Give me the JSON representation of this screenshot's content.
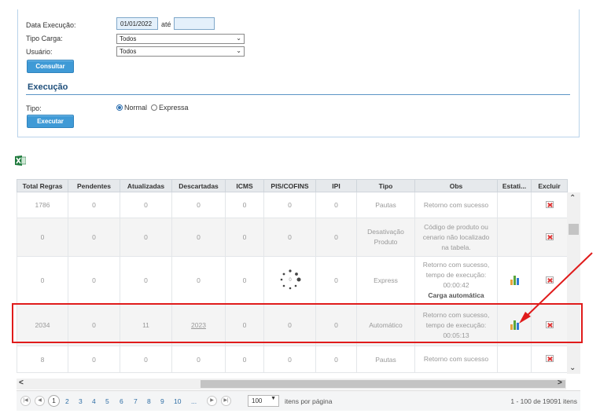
{
  "filters": {
    "data_execucao_label": "Data Execução:",
    "data_inicio": "01/01/2022",
    "ate_label": "até",
    "data_fim": "",
    "tipo_carga_label": "Tipo Carga:",
    "tipo_carga_value": "Todos",
    "usuario_label": "Usuário:",
    "usuario_value": "Todos",
    "consultar_label": "Consultar"
  },
  "execucao": {
    "title": "Execução",
    "tipo_label": "Tipo:",
    "option_normal": "Normal",
    "option_expressa": "Expressa",
    "selected": "Normal",
    "executar_label": "Executar"
  },
  "table": {
    "headers": [
      "Total Regras",
      "Pendentes",
      "Atualizadas",
      "Descartadas",
      "ICMS",
      "PIS/COFINS",
      "IPI",
      "Tipo",
      "Obs",
      "Estati...",
      "Excluir"
    ],
    "rows": [
      {
        "total": "1786",
        "pendentes": "0",
        "atualizadas": "0",
        "descartadas": "0",
        "icms": "0",
        "pis": "0",
        "ipi": "0",
        "tipo": "Pautas",
        "obs": [
          "Retorno com sucesso"
        ]
      },
      {
        "total": "0",
        "pendentes": "0",
        "atualizadas": "0",
        "descartadas": "0",
        "icms": "0",
        "pis": "0",
        "ipi": "0",
        "tipo": "Desativação Produto",
        "obs": [
          "Código de produto ou",
          "cenario não localizado",
          "na tabela."
        ]
      },
      {
        "total": "0",
        "pendentes": "0",
        "atualizadas": "0",
        "descartadas": "0",
        "icms": "0",
        "pis": "",
        "ipi": "0",
        "tipo": "Express",
        "obs": [
          "Retorno com sucesso,",
          "tempo de execução:",
          "00:00:42"
        ],
        "obs_bold": "Carga automática"
      },
      {
        "total": "2034",
        "pendentes": "0",
        "atualizadas": "11",
        "descartadas": "2023",
        "icms": "0",
        "pis": "0",
        "ipi": "0",
        "tipo": "Automático",
        "obs": [
          "Retorno com sucesso,",
          "tempo de execução:",
          "00:05:13"
        ]
      },
      {
        "total": "8",
        "pendentes": "0",
        "atualizadas": "0",
        "descartadas": "0",
        "icms": "0",
        "pis": "0",
        "ipi": "0",
        "tipo": "Pautas",
        "obs": [
          "Retorno com sucesso"
        ]
      }
    ]
  },
  "pager": {
    "pages": [
      "1",
      "2",
      "3",
      "4",
      "5",
      "6",
      "7",
      "8",
      "9",
      "10",
      "..."
    ],
    "current": "1",
    "page_size": "100",
    "items_per_page_label": "itens por página",
    "summary": "1 - 100 de 19091 itens"
  },
  "colors": {
    "highlight": "#e01b1b",
    "button": "#3f9ad6",
    "chart_bars": [
      "#e8a23b",
      "#5aa53b",
      "#2f7ad6"
    ]
  }
}
